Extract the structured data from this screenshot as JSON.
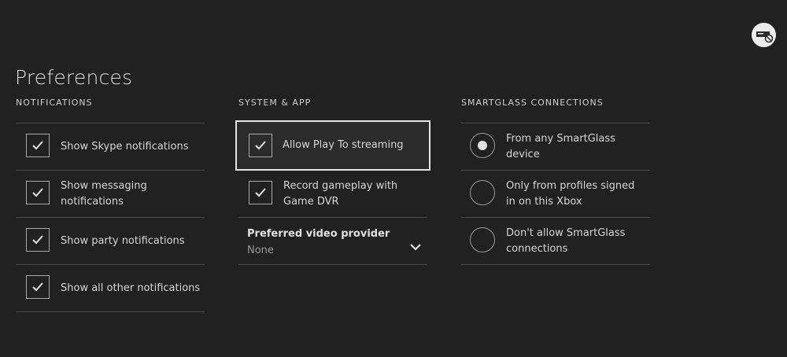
{
  "page": {
    "title": "Preferences"
  },
  "corner": {
    "icon": "console-network-blocked-icon"
  },
  "notifications": {
    "heading": "NOTIFICATIONS",
    "items": [
      {
        "label": "Show Skype notifications",
        "checked": true
      },
      {
        "label": "Show messaging notifications",
        "checked": true
      },
      {
        "label": "Show party notifications",
        "checked": true
      },
      {
        "label": "Show all other notifications",
        "checked": true
      }
    ]
  },
  "system_app": {
    "heading": "SYSTEM & APP",
    "items": [
      {
        "label": "Allow Play To streaming",
        "checked": true,
        "focused": true
      },
      {
        "label": "Record gameplay with Game DVR",
        "checked": true
      }
    ],
    "video_provider": {
      "label": "Preferred video provider",
      "value": "None",
      "icon": "chevron-down-icon"
    }
  },
  "smartglass": {
    "heading": "SMARTGLASS CONNECTIONS",
    "options": [
      {
        "label": "From any SmartGlass device",
        "selected": true
      },
      {
        "label": "Only from profiles signed in on this Xbox",
        "selected": false
      },
      {
        "label": "Don't allow SmartGlass connections",
        "selected": false
      }
    ]
  },
  "colors": {
    "background": "#212121",
    "text": "#d6d6d6",
    "divider": "#4a4a4a",
    "focus": "#e4e4e4"
  }
}
